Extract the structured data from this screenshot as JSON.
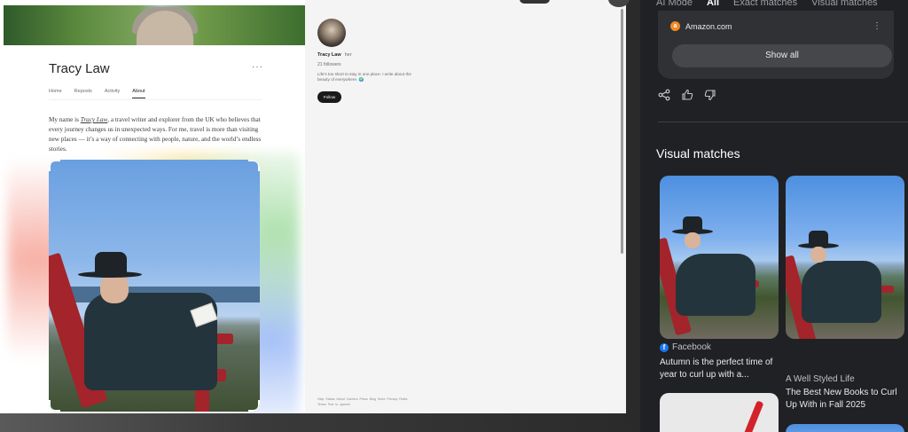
{
  "medium": {
    "author_name": "Tracy Law",
    "more_label": "···",
    "tabs": [
      {
        "label": "Home",
        "active": false
      },
      {
        "label": "Reposts",
        "active": false
      },
      {
        "label": "Activity",
        "active": false
      },
      {
        "label": "About",
        "active": true
      }
    ],
    "bio_before": "My name is ",
    "bio_link": "Tracy Law",
    "bio_after": ", a travel writer and explorer from the UK who believes that every journey changes us in unexpected ways. For me, travel is more than visiting new places — it’s a way of connecting with people, nature, and the world’s endless stories.",
    "sidebar": {
      "name": "Tracy Law",
      "pronoun": "her",
      "followers": "21 followers",
      "bio": "Life’s too short to stay in one place. I write about the beauty of everywhere. 🌍",
      "follow_label": "Follow",
      "footer": "Help  Status  About  Careers  Press  Blog  Store  Privacy  Rules  Terms  Text to speech"
    }
  },
  "lens": {
    "tabs": [
      {
        "label": "AI Mode",
        "active": false
      },
      {
        "label": "All",
        "active": true
      },
      {
        "label": "Exact matches",
        "active": false
      },
      {
        "label": "Visual matches",
        "active": false
      }
    ],
    "source_name": "Amazon.com",
    "source_icon": "a",
    "more_label": "⋮",
    "show_all_label": "Show all",
    "visual_matches_heading": "Visual matches",
    "matches": [
      {
        "source": "Facebook",
        "title": "Autumn is the perfect time of year to curl up with a..."
      },
      {
        "source": "A Well Styled Life",
        "title": "The Best New Books to Curl Up With in Fall 2025"
      }
    ]
  }
}
